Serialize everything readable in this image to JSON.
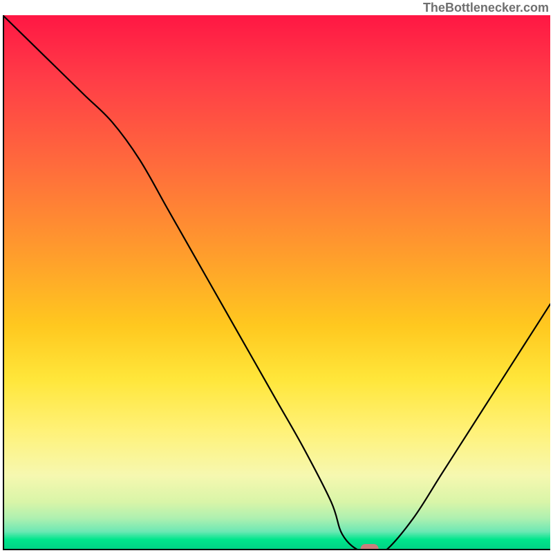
{
  "attribution": "TheBottlenecker.com",
  "chart_data": {
    "type": "line",
    "title": "",
    "xlabel": "",
    "ylabel": "",
    "xlim": [
      0,
      100
    ],
    "ylim": [
      0,
      100
    ],
    "x": [
      0,
      5,
      10,
      15,
      20,
      25,
      30,
      35,
      40,
      45,
      50,
      55,
      60,
      62,
      65,
      68,
      70,
      75,
      80,
      85,
      90,
      95,
      100
    ],
    "values": [
      100,
      95,
      90,
      85,
      80,
      73,
      64,
      55,
      46,
      37,
      28,
      19,
      9,
      3,
      0,
      0,
      0,
      6,
      14,
      22,
      30,
      38,
      46
    ],
    "marker": {
      "x": 67,
      "y": 0,
      "color": "#c97e7c"
    },
    "gradient_stops": [
      {
        "pos": 0.0,
        "color": "#ff1744"
      },
      {
        "pos": 0.45,
        "color": "#ff9e2c"
      },
      {
        "pos": 0.78,
        "color": "#fff27a"
      },
      {
        "pos": 1.0,
        "color": "#00d084"
      }
    ]
  }
}
